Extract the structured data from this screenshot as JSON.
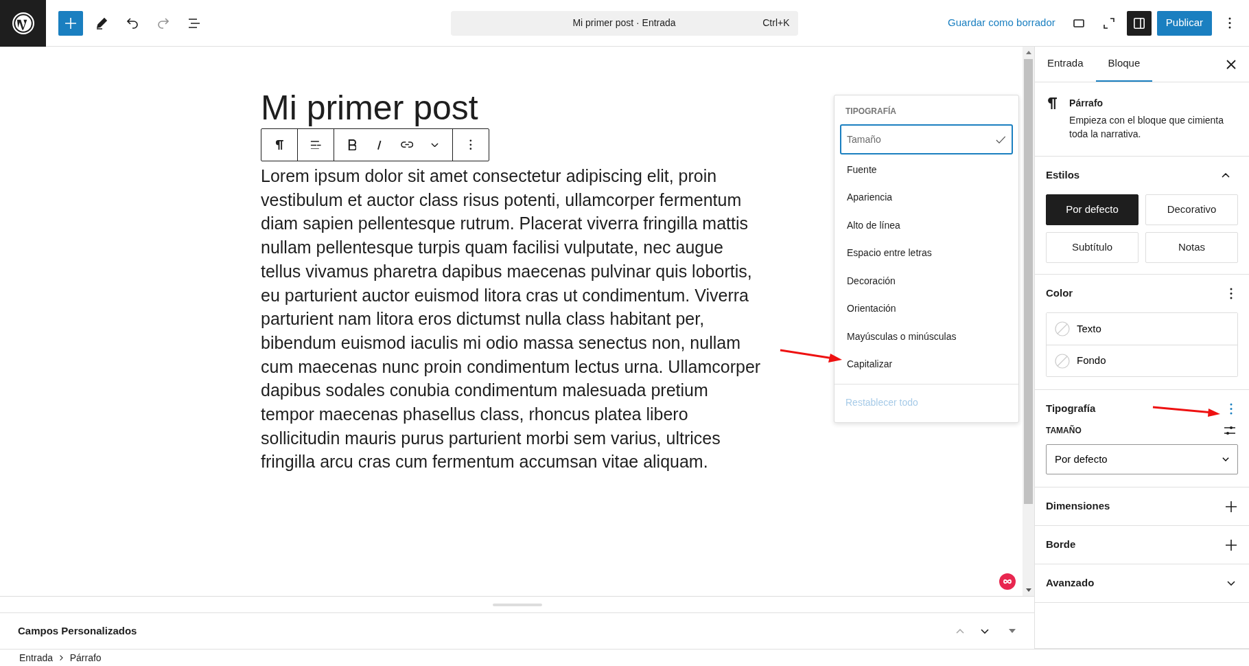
{
  "topbar": {
    "undo": {
      "disabled": false
    },
    "redo": {
      "disabled": true
    },
    "command_center": {
      "title": "Mi primer post · Entrada",
      "shortcut": "Ctrl+K"
    },
    "save_draft": "Guardar como borrador",
    "sidebar_toggle": {
      "on": true
    },
    "publish": "Publicar"
  },
  "editor": {
    "post_title": "Mi primer post",
    "paragraph": "Lorem ipsum dolor sit amet consectetur adipiscing elit, proin vestibulum et auctor class risus potenti, ullamcorper fermentum diam sapien pellentesque rutrum. Placerat viverra fringilla mattis nullam pellentesque turpis quam facilisi vulputate, nec augue tellus vivamus pharetra dapibus maecenas pulvinar quis lobortis, eu parturient auctor euismod litora cras ut condimentum. Viverra parturient nam litora eros dictumst nulla class habitant per, bibendum euismod iaculis mi odio massa senectus non, nullam cum maecenas nunc proin condimentum lectus urna. Ullamcorper dapibus sodales conubia condimentum malesuada pretium tempor maecenas phasellus class, rhoncus platea libero sollicitudin mauris purus parturient morbi sem varius, ultrices fringilla arcu cras cum fermentum accumsan vitae aliquam."
  },
  "typography_menu": {
    "heading": "TIPOGRAFÍA",
    "items": [
      {
        "label": "Tamaño",
        "checked": true,
        "focused": true
      },
      {
        "label": "Fuente",
        "checked": false,
        "focused": false
      },
      {
        "label": "Apariencia",
        "checked": false,
        "focused": false
      },
      {
        "label": "Alto de línea",
        "checked": false,
        "focused": false
      },
      {
        "label": "Espacio entre letras",
        "checked": false,
        "focused": false
      },
      {
        "label": "Decoración",
        "checked": false,
        "focused": false
      },
      {
        "label": "Orientación",
        "checked": false,
        "focused": false
      },
      {
        "label": "Mayúsculas o minúsculas",
        "checked": false,
        "focused": false
      },
      {
        "label": "Capitalizar",
        "checked": false,
        "focused": false
      }
    ],
    "reset": {
      "label": "Restablecer todo",
      "disabled": true
    }
  },
  "sidebar": {
    "tabs": [
      {
        "label": "Entrada",
        "selected": false
      },
      {
        "label": "Bloque",
        "selected": true
      }
    ],
    "block": {
      "name": "Párrafo",
      "description": "Empieza con el bloque que cimienta toda la narrativa."
    },
    "panels": [
      {
        "kind": "styles",
        "title": "Estilos",
        "expanded": true,
        "options": [
          {
            "label": "Por defecto",
            "selected": true
          },
          {
            "label": "Decorativo",
            "selected": false
          },
          {
            "label": "Subtítulo",
            "selected": false
          },
          {
            "label": "Notas",
            "selected": false
          }
        ]
      },
      {
        "kind": "color",
        "title": "Color",
        "menu_open": false,
        "items": [
          "Texto",
          "Fondo"
        ]
      },
      {
        "kind": "typography",
        "title": "Tipografía",
        "menu_open": true,
        "size_label": "TAMAÑO",
        "size_value": "Por defecto"
      },
      {
        "kind": "tools",
        "title": "Dimensiones"
      },
      {
        "kind": "tools",
        "title": "Borde"
      },
      {
        "kind": "section",
        "title": "Avanzado",
        "expanded": false
      }
    ]
  },
  "bottom_panel": {
    "title": "Campos Personalizados"
  },
  "breadcrumb": [
    "Entrada",
    "Párrafo"
  ]
}
